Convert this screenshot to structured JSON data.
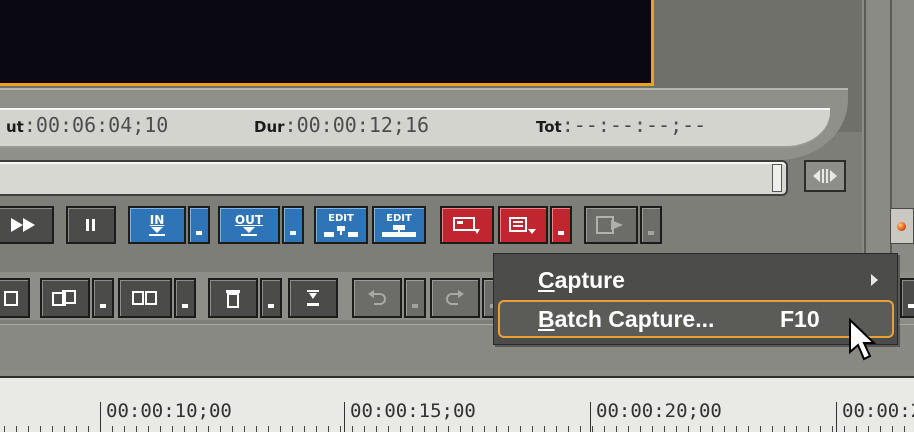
{
  "timecodes": {
    "out_label": "ut",
    "out_value": ":00:06:04;10",
    "dur_label": "Dur",
    "dur_value": ":00:00:12;16",
    "tot_label": "Tot",
    "tot_value": ":--:--:--;--"
  },
  "toolbar": {
    "in_label": "IN",
    "out_label": "OUT",
    "edit_label_1": "EDIT",
    "edit_label_2": "EDIT"
  },
  "context_menu": {
    "items": [
      {
        "label": "Capture",
        "mnemonic": "C",
        "rest": "apture",
        "has_submenu": true,
        "shortcut": ""
      },
      {
        "label": "Batch Capture...",
        "mnemonic": "B",
        "rest": "atch Capture...",
        "has_submenu": false,
        "shortcut": "F10",
        "highlighted": true
      }
    ]
  },
  "timeline": {
    "ticks": [
      "00:00:10;00",
      "00:00:15;00",
      "00:00:20;00",
      "00:00:2"
    ]
  },
  "colors": {
    "accent_orange": "#f0a01e",
    "button_blue": "#2f74b6",
    "button_red": "#c0262f",
    "menu_bg": "#4c4c4a"
  },
  "icons": [
    "fast-forward-icon",
    "pause-icon",
    "set-in-icon",
    "set-out-icon",
    "insert-edit-icon",
    "overwrite-edit-icon",
    "capture-icon",
    "batch-capture-icon",
    "export-icon",
    "split-view-icon",
    "paste-icon",
    "copy-clip-icon",
    "trim-icon",
    "delete-icon",
    "ripple-delete-icon",
    "undo-icon",
    "redo-icon",
    "submenu-arrow-icon",
    "mouse-cursor-icon"
  ]
}
